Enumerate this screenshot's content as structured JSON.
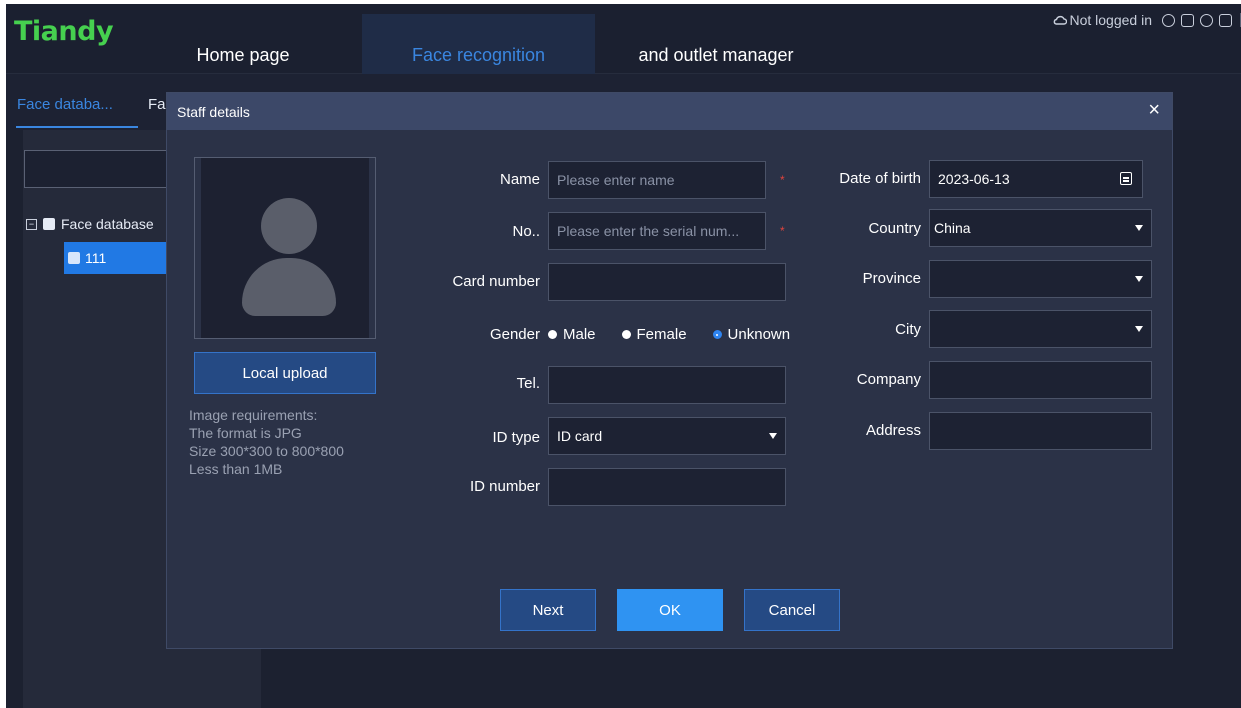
{
  "app": {
    "logo": "Tiandy"
  },
  "nav": {
    "items": [
      {
        "label": "Home page"
      },
      {
        "label": "Face recognition"
      },
      {
        "label": "and outlet manager"
      }
    ]
  },
  "status": {
    "login": "Not logged in"
  },
  "subtabs": [
    {
      "label": "Face databa..."
    },
    {
      "label": "Fa"
    }
  ],
  "tree": {
    "root": "Face database",
    "child": "111"
  },
  "modal": {
    "title": "Staff details",
    "close": "×",
    "upload_label": "Local upload",
    "requirements": [
      "Image requirements:",
      "The format is JPG",
      "Size 300*300 to 800*800",
      "Less than 1MB"
    ],
    "fields": {
      "name": {
        "label": "Name",
        "placeholder": "Please enter name",
        "required_mark": "*"
      },
      "no": {
        "label": "No..",
        "placeholder": "Please enter the serial num...",
        "required_mark": "*"
      },
      "card_number": {
        "label": "Card number",
        "value": ""
      },
      "gender": {
        "label": "Gender",
        "options": [
          "Male",
          "Female",
          "Unknown"
        ],
        "selected": "Unknown"
      },
      "tel": {
        "label": "Tel.",
        "value": ""
      },
      "id_type": {
        "label": "ID type",
        "value": "ID card"
      },
      "id_number": {
        "label": "ID number",
        "value": ""
      },
      "date_of_birth": {
        "label": "Date of birth",
        "value": "2023-06-13"
      },
      "country": {
        "label": "Country",
        "value": "China"
      },
      "province": {
        "label": "Province",
        "value": ""
      },
      "city": {
        "label": "City",
        "value": ""
      },
      "company": {
        "label": "Company",
        "value": ""
      },
      "address": {
        "label": "Address",
        "value": ""
      }
    },
    "buttons": {
      "next": "Next",
      "ok": "OK",
      "cancel": "Cancel"
    }
  },
  "colors": {
    "brand": "#46d04f",
    "accent": "#2f93f2",
    "required": "#e0443e"
  }
}
